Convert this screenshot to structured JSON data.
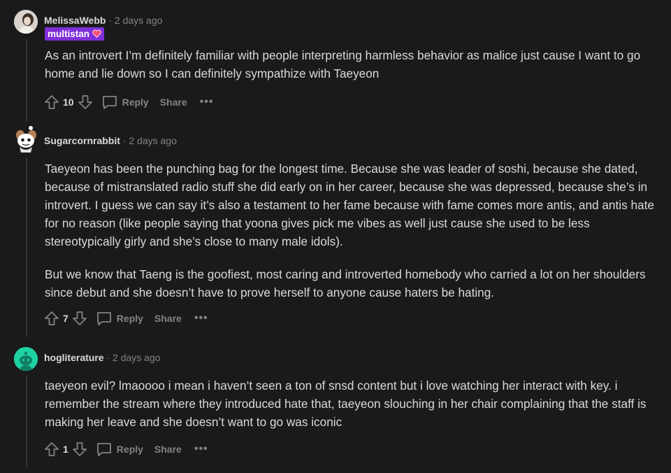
{
  "colors": {
    "background": "#1a1a1b",
    "text": "#d7dadc",
    "muted": "#818384",
    "flair": "#7e2fd8",
    "heart": "#ff4f6e"
  },
  "comments": [
    {
      "author": "MelissaWebb",
      "time": "2 days ago",
      "flair": "multistan",
      "flair_icon": "heart-icon",
      "avatar_icon": "user-avatar-photo",
      "paragraphs": [
        "As an introvert I’m definitely familiar with people interpreting harmless behavior as malice just cause I want to go home and lie down so I can definitely sympathize with Taeyeon"
      ],
      "score": "10",
      "reply_label": "Reply",
      "share_label": "Share",
      "more_label": "•••"
    },
    {
      "author": "Sugarcornrabbit",
      "time": "2 days ago",
      "avatar_icon": "snoo-avatar",
      "paragraphs": [
        "Taeyeon has been the punching bag for the longest time. Because she was leader of soshi, because she dated, because of mistranslated radio stuff she did early on in her career, because she was depressed, because she’s in introvert. I guess we can say it’s also a testament to her fame because with fame comes more antis, and antis hate for no reason (like people saying that yoona gives pick me vibes as well just cause she used to be less stereotypically girly and she’s close to many male idols).",
        "But we know that Taeng is the goofiest, most caring and introverted homebody who carried a lot on her shoulders since debut and she doesn’t have to prove herself to anyone cause haters be hating."
      ],
      "score": "7",
      "reply_label": "Reply",
      "share_label": "Share",
      "more_label": "•••"
    },
    {
      "author": "hogliterature",
      "time": "2 days ago",
      "avatar_icon": "snoo-default-avatar",
      "paragraphs": [
        "taeyeon evil? lmaoooo i mean i haven’t seen a ton of snsd content but i love watching her interact with key. i remember the stream where they introduced hate that, taeyeon slouching in her chair complaining that the staff is making her leave and she doesn’t want to go was iconic"
      ],
      "score": "1",
      "reply_label": "Reply",
      "share_label": "Share",
      "more_label": "•••"
    }
  ]
}
